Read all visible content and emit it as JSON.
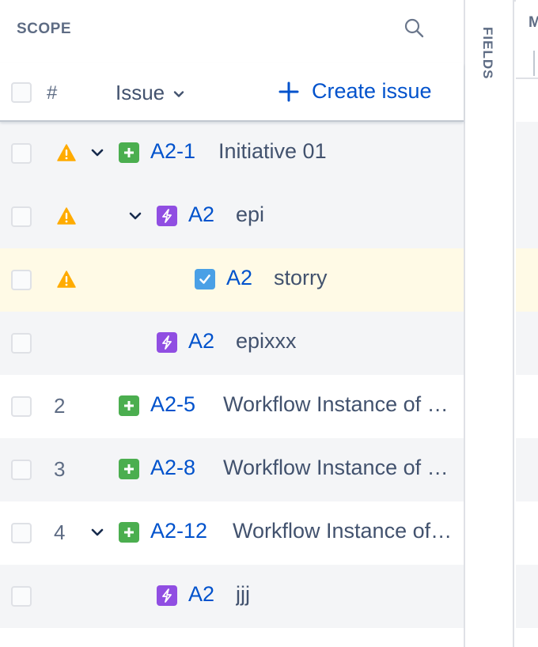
{
  "scope": {
    "title": "SCOPE",
    "header": {
      "hash": "#",
      "issue_label": "Issue",
      "create_label": "Create issue"
    },
    "rows": [
      {
        "num": "",
        "warning": true,
        "expanded": true,
        "type": "initiative",
        "key": "A2-1",
        "summary": "Initiative 01"
      },
      {
        "num": "",
        "warning": true,
        "expanded": true,
        "type": "epic",
        "key": "A2",
        "summary": "epi"
      },
      {
        "num": "",
        "warning": true,
        "expanded": false,
        "type": "story",
        "key": "A2",
        "summary": "storry"
      },
      {
        "num": "",
        "warning": false,
        "expanded": false,
        "type": "epic",
        "key": "A2",
        "summary": "epixxx"
      },
      {
        "num": "2",
        "warning": false,
        "expanded": false,
        "type": "initiative",
        "key": "A2-5",
        "summary": "Workflow Instance of Initiative"
      },
      {
        "num": "3",
        "warning": false,
        "expanded": false,
        "type": "initiative",
        "key": "A2-8",
        "summary": "Workflow Instance of Initiative"
      },
      {
        "num": "4",
        "warning": false,
        "expanded": true,
        "type": "initiative",
        "key": "A2-12",
        "summary": "Workflow Instance of Initiative"
      },
      {
        "num": "",
        "warning": false,
        "expanded": false,
        "type": "epic",
        "key": "A2",
        "summary": "jjj"
      }
    ]
  },
  "fields_panel": {
    "label": "FIELDS"
  },
  "right_panel": {
    "header_letter": "M"
  },
  "colors": {
    "link": "#0052cc",
    "initiative": "#4bae4f",
    "epic": "#904ee2",
    "story": "#4aa0e6",
    "warning": "#ffab00",
    "row_alt": "#f4f5f7",
    "row_highlight": "#fffae6"
  },
  "icons": {
    "search": "search-icon",
    "chevron": "chevron-down-icon",
    "plus": "plus-icon",
    "warning": "warning-icon",
    "initiative": "initiative-icon",
    "epic": "epic-icon",
    "story": "story-icon"
  }
}
